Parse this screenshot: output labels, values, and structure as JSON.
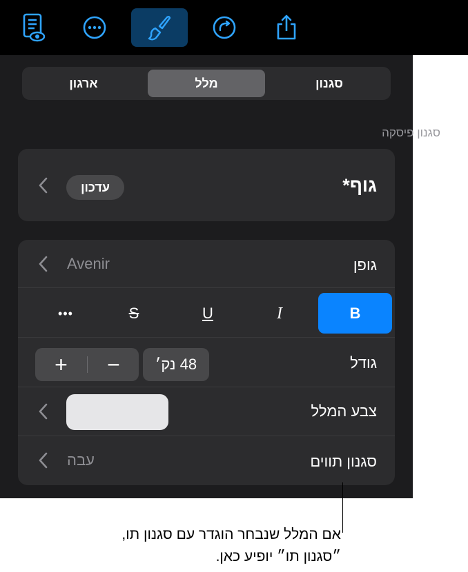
{
  "toolbar": {
    "buttons": [
      {
        "icon": "document-view-icon"
      },
      {
        "icon": "more-icon"
      },
      {
        "icon": "format-brush-icon",
        "active": true
      },
      {
        "icon": "redo-icon"
      },
      {
        "icon": "share-icon"
      }
    ],
    "active_color": "#0b3c64",
    "icon_color": "#2fa4ff"
  },
  "tabs": [
    {
      "label": "סגנון"
    },
    {
      "label": "מלל",
      "selected": true
    },
    {
      "label": "ארגון"
    }
  ],
  "paragraph_style": {
    "section_label": "סגנון פיסקה",
    "name": "גוף*",
    "update_label": "עדכון"
  },
  "font": {
    "label": "גופן",
    "value": "Avenir"
  },
  "text_styles": {
    "bold": "B",
    "italic": "I",
    "underline": "U",
    "strikethrough": "S",
    "more": "•••"
  },
  "size": {
    "label": "גודל",
    "value": "48 נק׳",
    "increment": "+",
    "decrement": "−"
  },
  "text_color": {
    "label": "צבע המלל",
    "swatch": "#e6e6e8"
  },
  "char_style": {
    "label": "סגנון תווים",
    "value": "עבה"
  },
  "callout": {
    "line1": "אם המלל שנבחר הוגדר עם סגנון תו,",
    "line2": "״סגנון תו״ יופיע כאן."
  }
}
